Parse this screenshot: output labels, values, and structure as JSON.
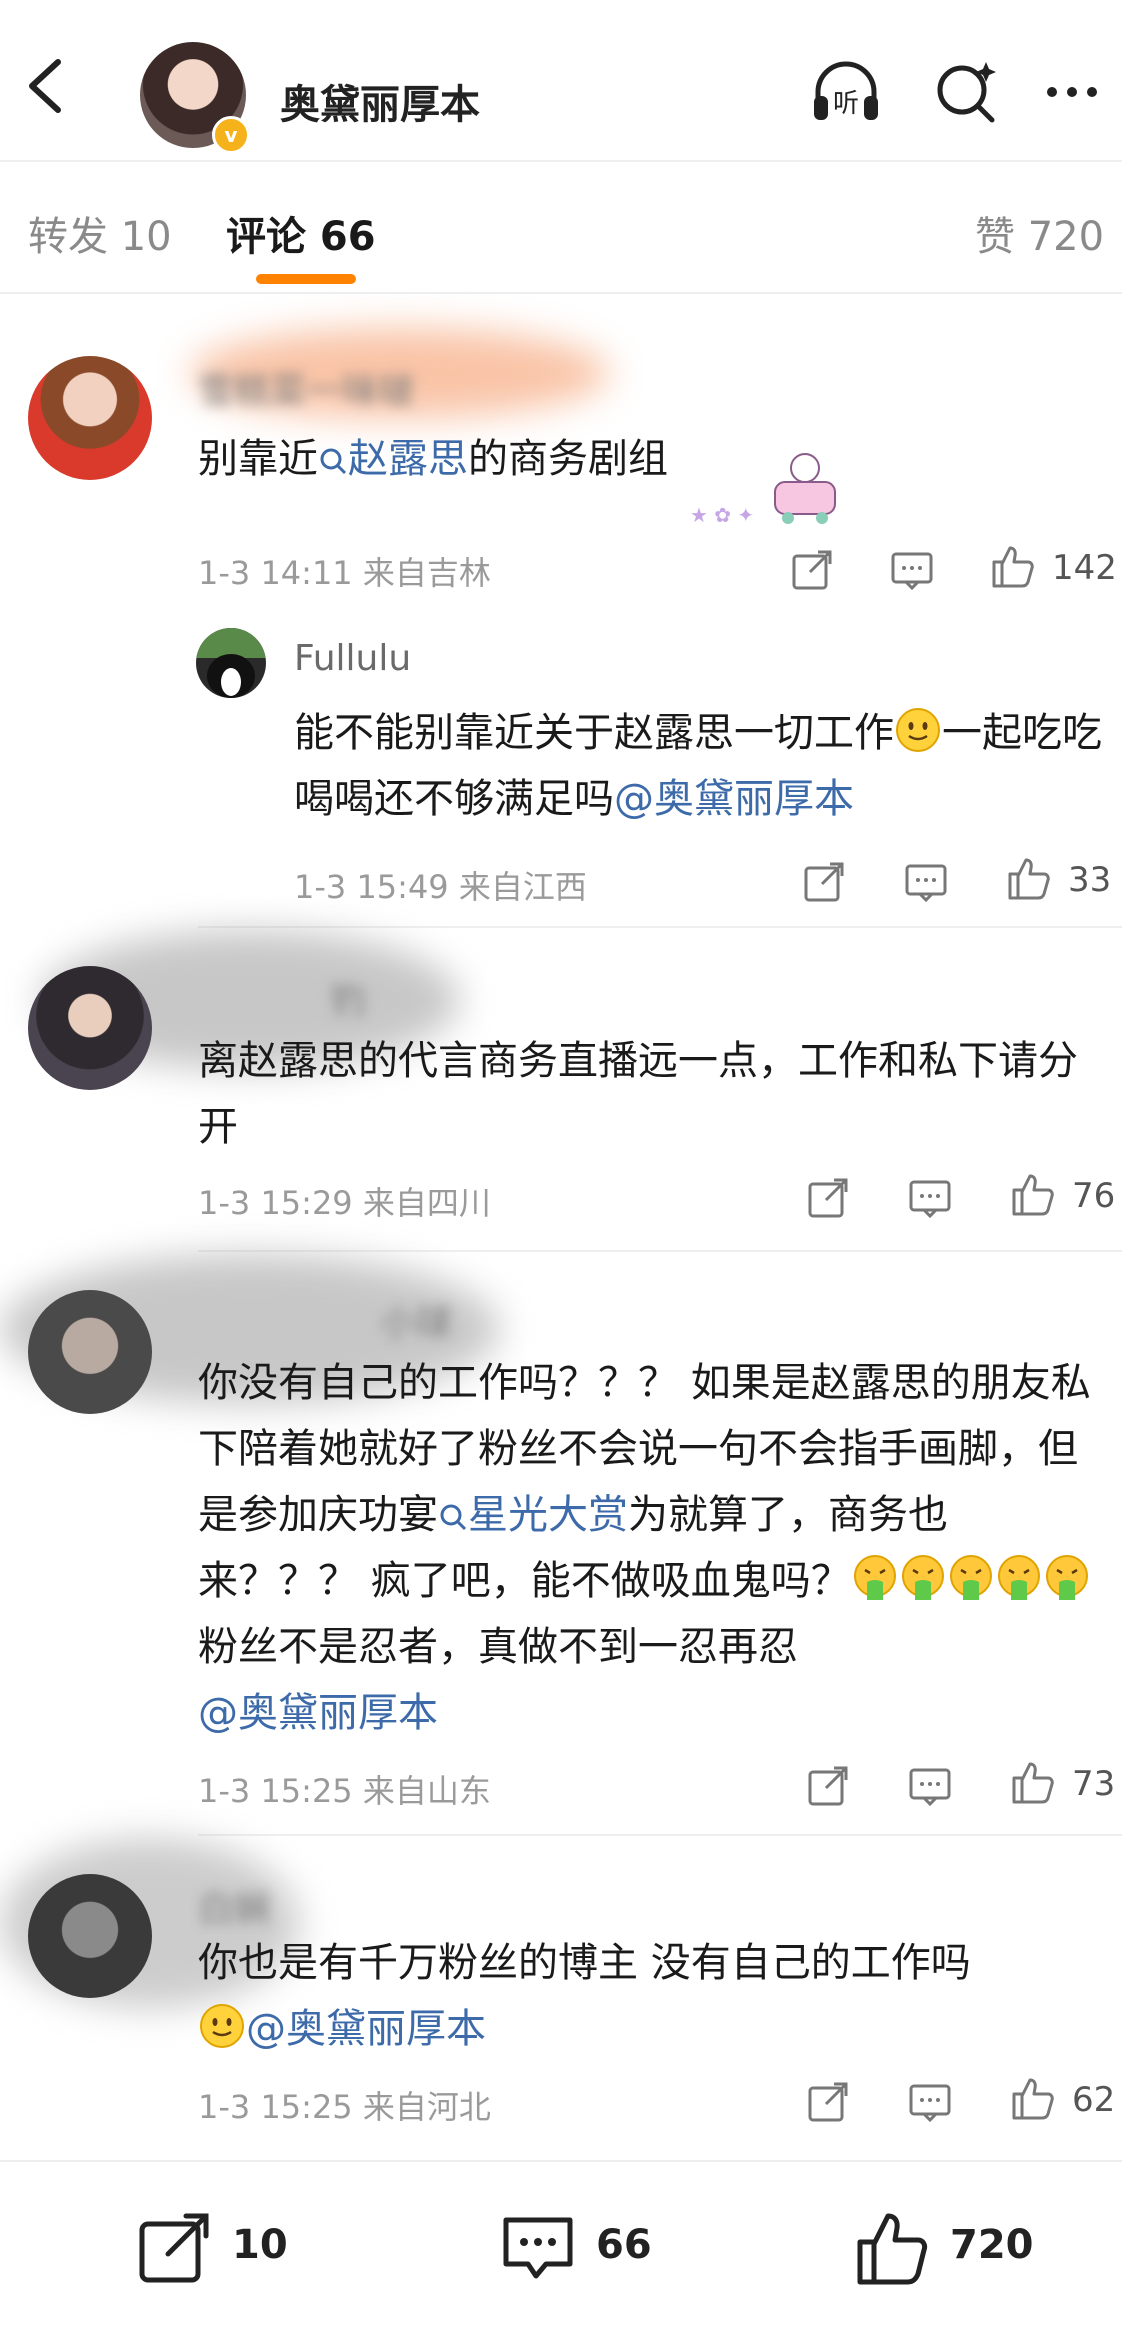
{
  "header": {
    "title": "奥黛丽厚本",
    "listen_label": "听"
  },
  "tabs": {
    "repost": "转发 10",
    "comments": "评论 66",
    "likes": "赞 720"
  },
  "comments": [
    {
      "name": "雪糕菜一味啵",
      "text_before": "别靠近",
      "link": "赵露思",
      "text_after": "的商务剧组",
      "meta": "1-3 14:11 来自吉林",
      "likes": "142",
      "reply": {
        "name": "Fullulu",
        "text_part1": "能不能别靠近关于赵露思一切工作",
        "text_part2": "一起吃吃喝喝还不够满足吗",
        "mention": "@奥黛丽厚本",
        "meta": "1-3 15:49 来自江西",
        "likes": "33"
      }
    },
    {
      "name": "钓",
      "text": "离赵露思的代言商务直播远一点，工作和私下请分开",
      "meta": "1-3 15:29 来自四川",
      "likes": "76"
    },
    {
      "name": "小球",
      "text_part1": "你没有自己的工作吗？？？ 如果是赵露思的朋友私下陪着她就好了粉丝不会说一句不会指手画脚，但是参加庆功宴",
      "link": "星光大赏",
      "text_part2": "为就算了，商务也来？？？ 疯了吧，能不做吸血鬼吗？",
      "text_part3": "粉丝不是忍者，真做不到一忍再忍",
      "mention": "@奥黛丽厚本",
      "meta": "1-3 15:25 来自山东",
      "likes": "73"
    },
    {
      "name": "白娴",
      "text": "你也是有千万粉丝的博主 没有自己的工作吗",
      "mention": "@奥黛丽厚本",
      "meta": "1-3 15:25 来自河北",
      "likes": "62"
    }
  ],
  "bottom": {
    "repost": "10",
    "comment": "66",
    "like": "720"
  },
  "colors": {
    "accent": "#ff8200",
    "link": "#3d6aa8"
  }
}
